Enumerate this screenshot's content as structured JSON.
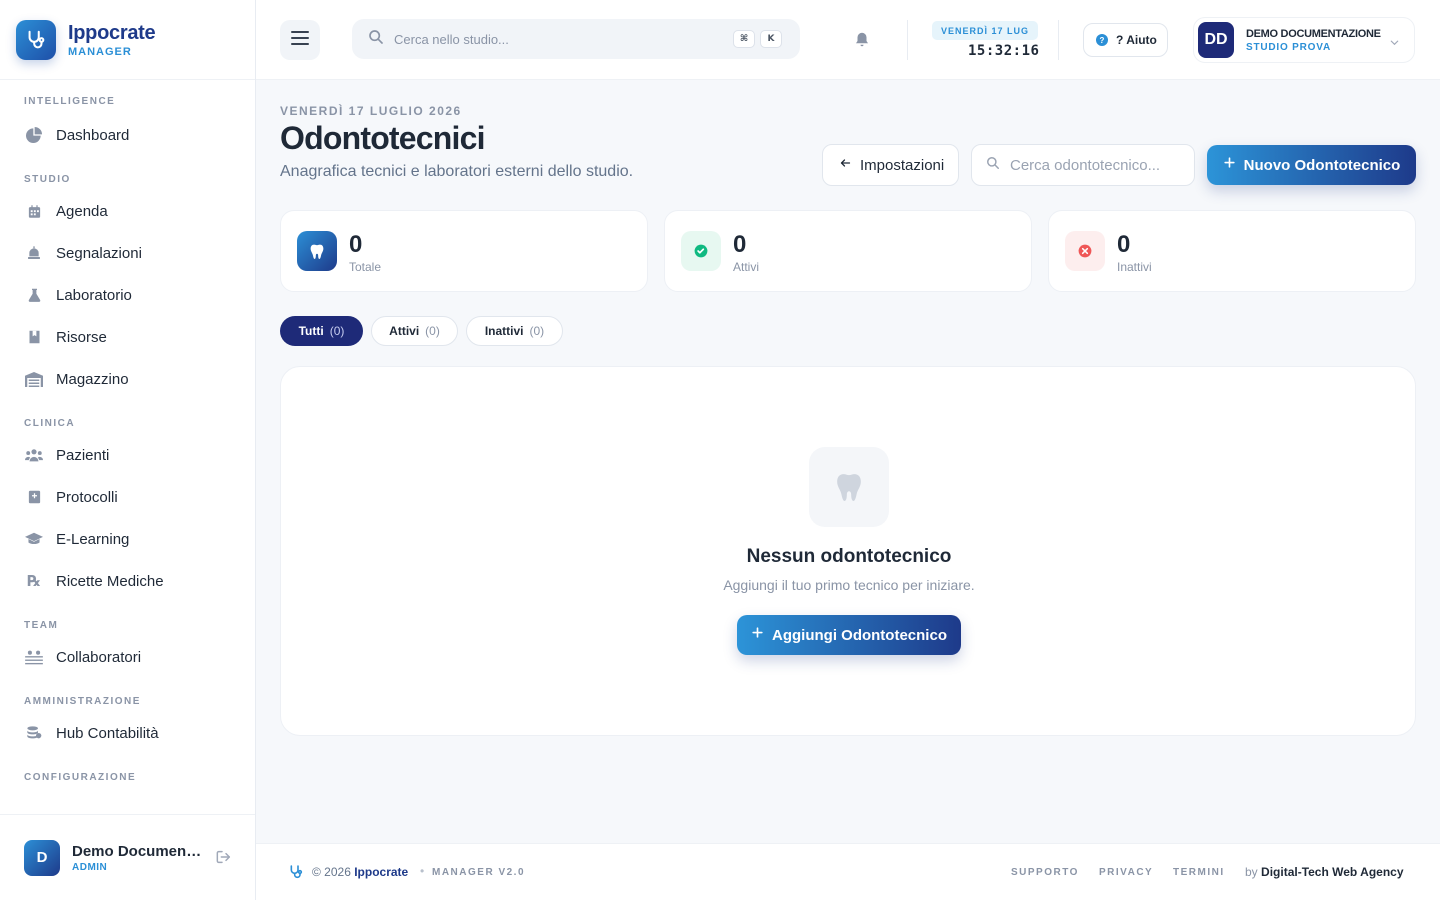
{
  "brand": {
    "name": "Ippocrate",
    "subtitle": "MANAGER"
  },
  "sidebar": {
    "sections": [
      {
        "title": "INTELLIGENCE",
        "items": [
          {
            "label": "Dashboard",
            "icon": "pie-chart-icon"
          }
        ]
      },
      {
        "title": "STUDIO",
        "items": [
          {
            "label": "Agenda",
            "icon": "calendar-icon"
          },
          {
            "label": "Segnalazioni",
            "icon": "bell-alert-icon"
          },
          {
            "label": "Laboratorio",
            "icon": "flask-icon"
          },
          {
            "label": "Risorse",
            "icon": "bookmark-icon"
          },
          {
            "label": "Magazzino",
            "icon": "warehouse-icon"
          }
        ]
      },
      {
        "title": "CLINICA",
        "items": [
          {
            "label": "Pazienti",
            "icon": "users-icon"
          },
          {
            "label": "Protocolli",
            "icon": "medical-book-icon"
          },
          {
            "label": "E-Learning",
            "icon": "graduation-cap-icon"
          },
          {
            "label": "Ricette Mediche",
            "icon": "prescription-icon"
          }
        ]
      },
      {
        "title": "TEAM",
        "items": [
          {
            "label": "Collaboratori",
            "icon": "team-icon"
          }
        ]
      },
      {
        "title": "AMMINISTRAZIONE",
        "items": [
          {
            "label": "Hub Contabilità",
            "icon": "coins-icon"
          }
        ]
      },
      {
        "title": "CONFIGURAZIONE",
        "items": []
      }
    ],
    "user": {
      "initial": "D",
      "name": "Demo Documentazione",
      "role": "ADMIN"
    }
  },
  "header": {
    "search_placeholder": "Cerca nello studio...",
    "kbd_mod": "⌘",
    "kbd_key": "K",
    "date_badge": "VENERDÌ 17 LUG",
    "clock": "15:32:16",
    "help_label": "? Aiuto",
    "account": {
      "initials": "DD",
      "name": "DEMO DOCUMENTAZIONE",
      "studio": "STUDIO PROVA"
    }
  },
  "page": {
    "date": "VENERDÌ 17 LUGLIO 2026",
    "title": "Odontotecnici",
    "subtitle": "Anagrafica tecnici e laboratori esterni dello studio.",
    "back_label": "Impostazioni",
    "search_placeholder": "Cerca odontotecnico...",
    "new_label": "Nuovo Odontotecnico"
  },
  "stats": [
    {
      "value": "0",
      "label": "Totale",
      "color": "#2c8fd6"
    },
    {
      "value": "0",
      "label": "Attivi",
      "color": "#10b981"
    },
    {
      "value": "0",
      "label": "Inattivi",
      "color": "#ef4444"
    }
  ],
  "filters": [
    {
      "label": "Tutti",
      "count": "(0)",
      "active": true
    },
    {
      "label": "Attivi",
      "count": "(0)",
      "active": false
    },
    {
      "label": "Inattivi",
      "count": "(0)",
      "active": false
    }
  ],
  "empty": {
    "title": "Nessun odontotecnico",
    "subtitle": "Aggiungi il tuo primo tecnico per iniziare.",
    "button": "Aggiungi Odontotecnico"
  },
  "footer": {
    "copyright": "© 2026",
    "brand": "Ippocrate",
    "version": "MANAGER V2.0",
    "links": [
      "SUPPORTO",
      "PRIVACY",
      "TERMINI"
    ],
    "by": "by",
    "agency": "Digital-Tech Web Agency"
  },
  "colors": {
    "accent": "#2c8fd6",
    "brand_dark": "#1e2a78"
  }
}
